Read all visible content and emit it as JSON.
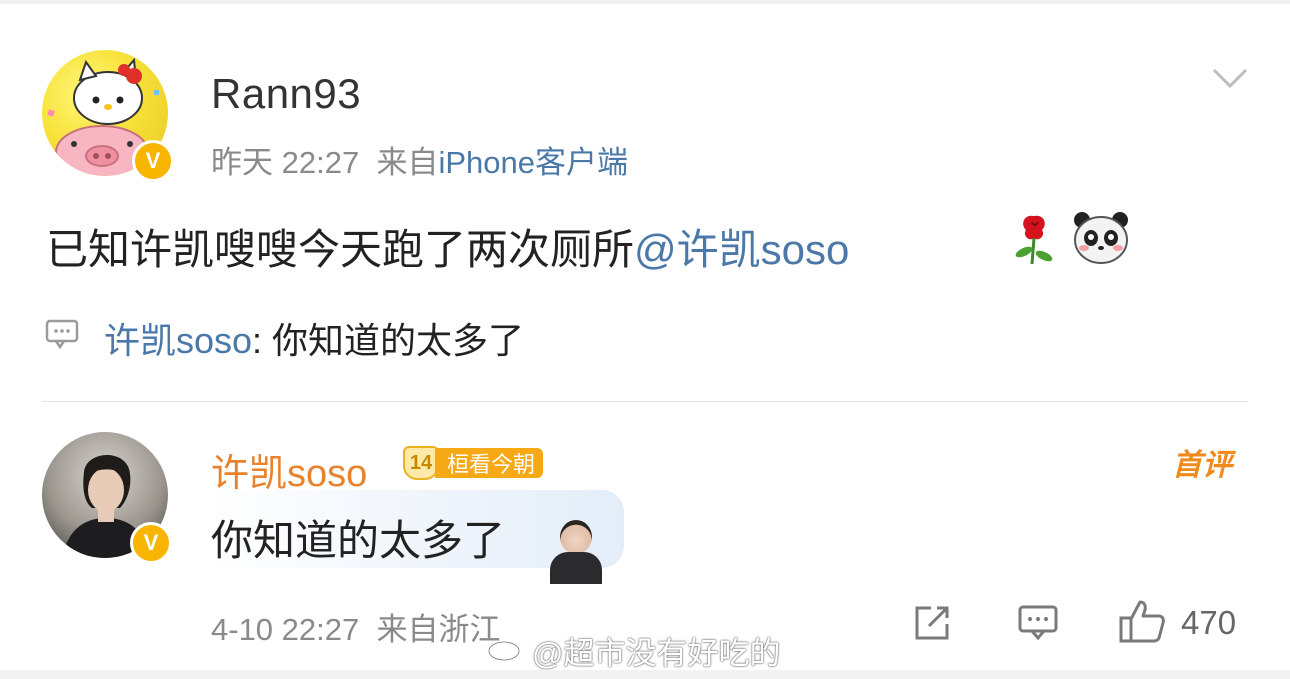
{
  "post": {
    "username": "Rann93",
    "time": "昨天 22:27",
    "source_prefix": "来自",
    "source": "iPhone客户端",
    "text": "已知许凯嗖嗖今天跑了两次厕所",
    "mention": "@许凯soso",
    "emojis": [
      "rose-emoji",
      "panda-emoji"
    ],
    "verified_badge": "V"
  },
  "comment_preview": {
    "name": "许凯soso",
    "text": ": 你知道的太多了"
  },
  "comment": {
    "name": "许凯soso",
    "level": "14",
    "badge_text": "桓看今朝",
    "first_comment_label": "首评",
    "text": "你知道的太多了",
    "time": "4-10 22:27",
    "location": "来自浙江",
    "verified_badge": "V"
  },
  "actions": {
    "like_count": "470",
    "icons": [
      "share-icon",
      "comment-icon",
      "like-icon"
    ]
  },
  "watermark": "@超市没有好吃的",
  "colors": {
    "link": "#4a78a8",
    "orange_name": "#e8822c",
    "gold_badge": "#f6a815",
    "gray_text": "#8a8a8a"
  }
}
